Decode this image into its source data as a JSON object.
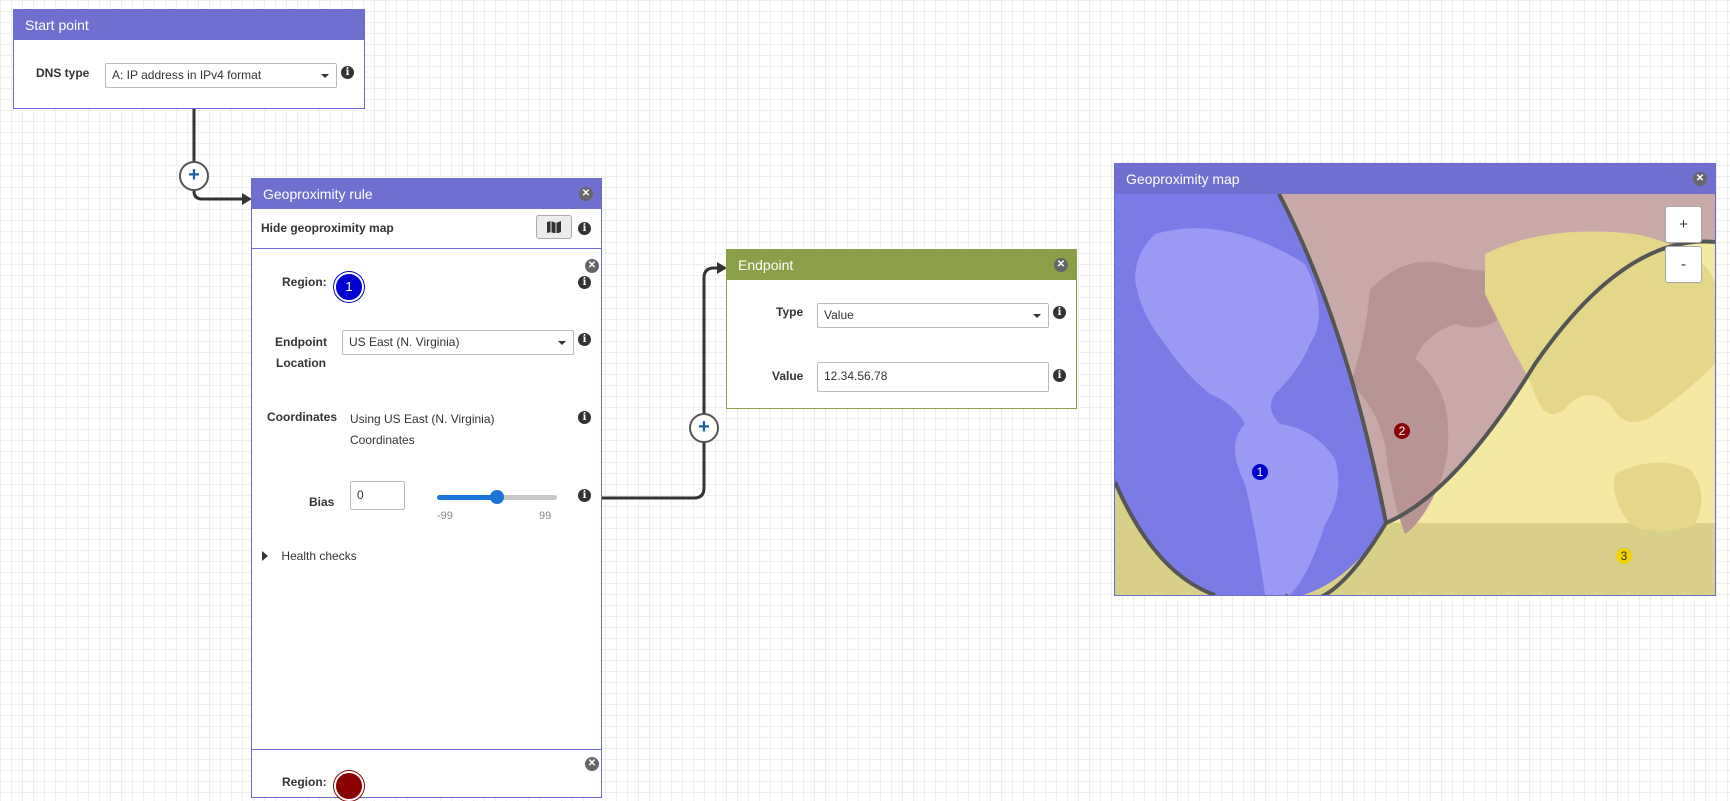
{
  "start_point": {
    "title": "Start point",
    "dns_type_label": "DNS type",
    "dns_type_value": "A: IP address in IPv4 format"
  },
  "geo_rule": {
    "title": "Geoproximity rule",
    "hide_map_label": "Hide geoproximity map",
    "region_label": "Region:",
    "region_number": "1",
    "endpoint_label_line1": "Endpoint",
    "endpoint_label_line2": "Location",
    "endpoint_location": "US East (N. Virginia)",
    "coordinates_label": "Coordinates",
    "coordinates_line1": "Using US East (N. Virginia)",
    "coordinates_line2": "Coordinates",
    "bias_label": "Bias",
    "bias_value": "0",
    "bias_min": "-99",
    "bias_max": "99",
    "health_checks": "Health checks",
    "second_region_label": "Region:"
  },
  "endpoint": {
    "title": "Endpoint",
    "type_label": "Type",
    "type_value": "Value",
    "value_label": "Value",
    "value_value": "12.34.56.78"
  },
  "geo_map": {
    "title": "Geoproximity map",
    "zoom_in": "+",
    "zoom_out": "-",
    "markers": [
      "1",
      "2",
      "3"
    ]
  },
  "colors": {
    "panel_header": "#6f6fd0",
    "endpoint_header": "#8b9f48",
    "region1": "#0000d0",
    "region2": "#8b0000",
    "region3": "#f2d200"
  }
}
